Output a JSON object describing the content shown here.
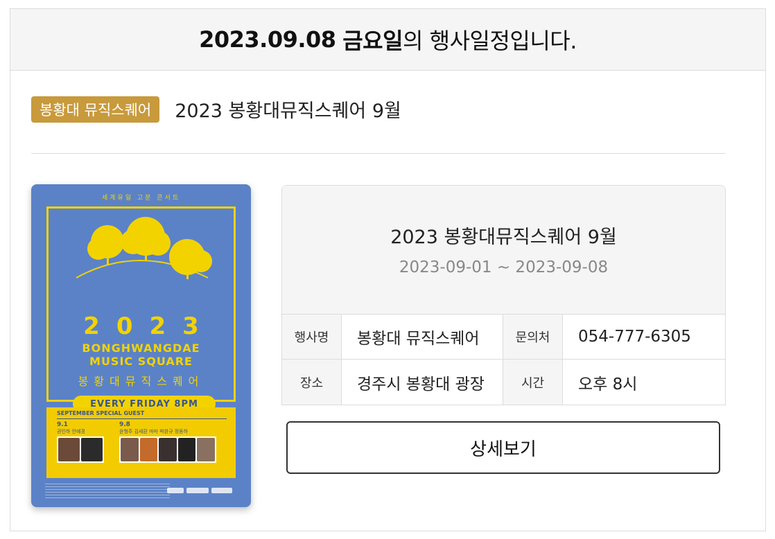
{
  "header": {
    "date": "2023.09.08",
    "weekday": "금요일",
    "suffix": "의 행사일정입니다."
  },
  "event": {
    "category": "봉황대 뮤직스퀘어",
    "title": "2023 봉황대뮤직스퀘어 9월"
  },
  "poster": {
    "top_text": "세계유일 고분 콘서트",
    "year": "2023",
    "en_line1": "BONGHWANGDAE",
    "en_line2": "MUSIC SQUARE",
    "kr_name": "봉황대뮤직스퀘어",
    "schedule": "EVERY FRIDAY 8PM",
    "guest_title": "SEPTEMBER SPECIAL GUEST",
    "guest_date1": "9.1",
    "guest_names1": "권인하 안예경",
    "guest_date2": "9.8",
    "guest_names2": "윤형주 김세환 마마 박완규 정동하"
  },
  "info": {
    "title": "2023 봉황대뮤직스퀘어 9월",
    "period": "2023-09-01 ~ 2023-09-08",
    "labels": {
      "name": "행사명",
      "contact": "문의처",
      "place": "장소",
      "time": "시간"
    },
    "values": {
      "name": "봉황대 뮤직스퀘어",
      "contact": "054-777-6305",
      "place": "경주시 봉황대 광장",
      "time": "오후 8시"
    }
  },
  "detail_button": "상세보기",
  "colors": {
    "badge": "#c89a3c",
    "poster_bg": "#5b82c7",
    "poster_yellow": "#f2d300"
  }
}
